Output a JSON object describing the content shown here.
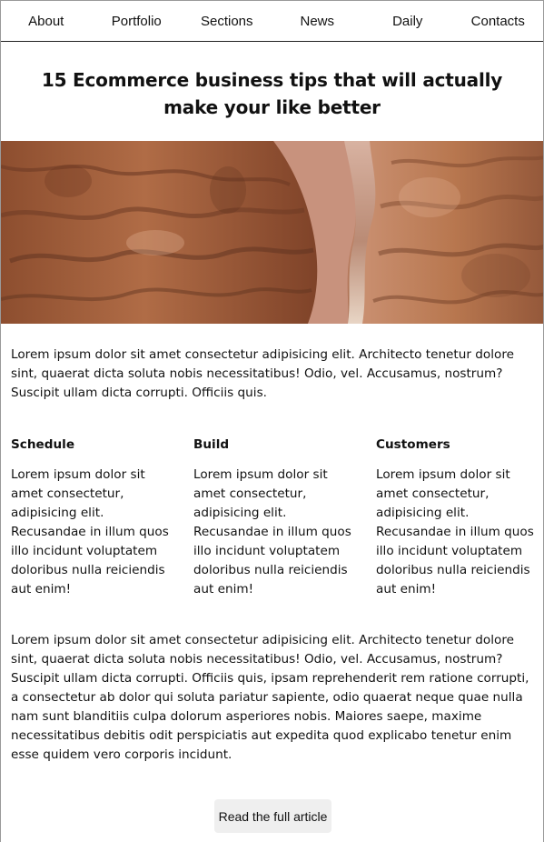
{
  "nav": {
    "items": [
      {
        "label": "About"
      },
      {
        "label": "Portfolio"
      },
      {
        "label": "Sections"
      },
      {
        "label": "News"
      },
      {
        "label": "Daily"
      },
      {
        "label": "Contacts"
      }
    ]
  },
  "article": {
    "title": "15 Ecommerce business tips that will actually make your like better",
    "intro": "Lorem ipsum dolor sit amet consectetur adipisicing elit. Architecto tenetur dolore sint, quaerat dicta soluta nobis necessitatibus! Odio, vel. Accusamus, nostrum? Suscipit ullam dicta corrupti. Officiis quis.",
    "features": [
      {
        "title": "Schedule",
        "text": "Lorem ipsum dolor sit amet consectetur, adipisicing elit. Recusandae in illum quos illo incidunt voluptatem doloribus nulla reiciendis aut enim!"
      },
      {
        "title": "Build",
        "text": "Lorem ipsum dolor sit amet consectetur, adipisicing elit. Recusandae in illum quos illo incidunt voluptatem doloribus nulla reiciendis aut enim!"
      },
      {
        "title": "Customers",
        "text": "Lorem ipsum dolor sit amet consectetur, adipisicing elit. Recusandae in illum quos illo incidunt voluptatem doloribus nulla reiciendis aut enim!"
      }
    ],
    "body": "Lorem ipsum dolor sit amet consectetur adipisicing elit. Architecto tenetur dolore sint, quaerat dicta soluta nobis necessitatibus! Odio, vel. Accusamus, nostrum? Suscipit ullam dicta corrupti. Officiis quis, ipsam reprehenderit rem ratione corrupti, a consectetur ab dolor qui soluta pariatur sapiente, odio quaerat neque quae nulla nam sunt blanditiis culpa dolorum asperiores nobis. Maiores saepe, maxime necessitatibus debitis odit perspiciatis aut expedita quod explicabo tenetur enim esse quidem vero corporis incidunt.",
    "cta_label": "Read the full article"
  },
  "colors": {
    "nav_border": "#222222",
    "button_bg": "#efefef",
    "canyon_dark": "#6e3b25",
    "canyon_mid": "#a8643f",
    "canyon_light": "#d79b75",
    "canyon_pale": "#e7c2a8"
  }
}
